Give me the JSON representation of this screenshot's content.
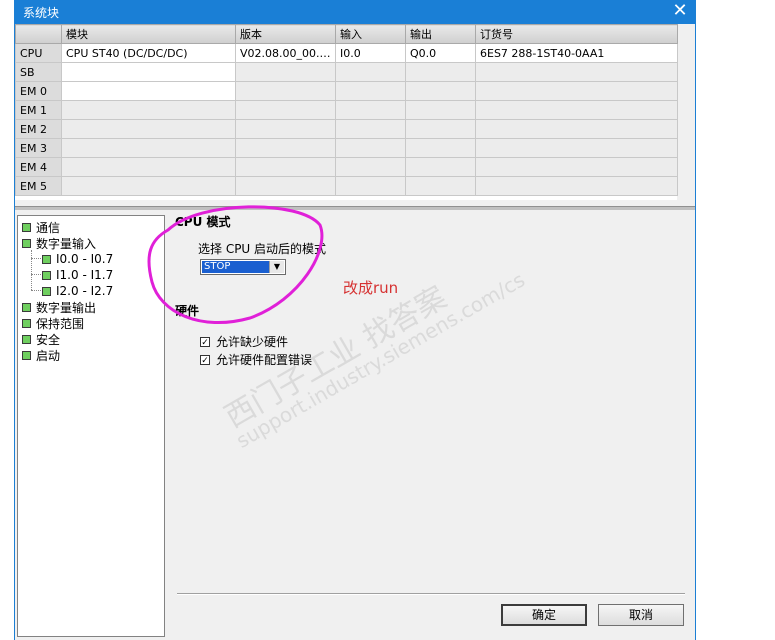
{
  "window": {
    "title": "系统块",
    "close_glyph": "✕"
  },
  "grid": {
    "columns": [
      "",
      "模块",
      "版本",
      "输入",
      "输出",
      "订货号"
    ],
    "rows": [
      {
        "slot": "CPU",
        "module": "CPU ST40 (DC/DC/DC)",
        "version": "V02.08.00_00.00...",
        "input": "I0.0",
        "output": "Q0.0",
        "order": "6ES7 288-1ST40-0AA1"
      },
      {
        "slot": "SB",
        "module": "",
        "version": "",
        "input": "",
        "output": "",
        "order": ""
      },
      {
        "slot": "EM 0",
        "module": "",
        "version": "",
        "input": "",
        "output": "",
        "order": ""
      },
      {
        "slot": "EM 1",
        "module": "",
        "version": "",
        "input": "",
        "output": "",
        "order": ""
      },
      {
        "slot": "EM 2",
        "module": "",
        "version": "",
        "input": "",
        "output": "",
        "order": ""
      },
      {
        "slot": "EM 3",
        "module": "",
        "version": "",
        "input": "",
        "output": "",
        "order": ""
      },
      {
        "slot": "EM 4",
        "module": "",
        "version": "",
        "input": "",
        "output": "",
        "order": ""
      },
      {
        "slot": "EM 5",
        "module": "",
        "version": "",
        "input": "",
        "output": "",
        "order": ""
      }
    ]
  },
  "tree": {
    "items": [
      {
        "label": "通信"
      },
      {
        "label": "数字量输入"
      },
      {
        "label": "I0.0 - I0.7"
      },
      {
        "label": "I1.0 - I1.7"
      },
      {
        "label": "I2.0 - I2.7"
      },
      {
        "label": "数字量输出"
      },
      {
        "label": "保持范围"
      },
      {
        "label": "安全"
      },
      {
        "label": "启动"
      }
    ]
  },
  "content": {
    "cpu_mode_title": "CPU 模式",
    "startup_label": "选择 CPU 启动后的模式",
    "startup_value": "STOP",
    "hardware_title": "硬件",
    "allow_missing_hw": "允许缺少硬件",
    "allow_hw_config_error": "允许硬件配置错误",
    "annotation": "改成run"
  },
  "buttons": {
    "ok": "确定",
    "cancel": "取消"
  },
  "watermark": {
    "line1": "西门子工业 找答案",
    "line2": "support.industry.siemens.com/cs"
  },
  "colors": {
    "titlebar": "#1a7fd6",
    "annotation": "#d63232",
    "circle": "#e020d8",
    "selection": "#1a5fd0"
  }
}
